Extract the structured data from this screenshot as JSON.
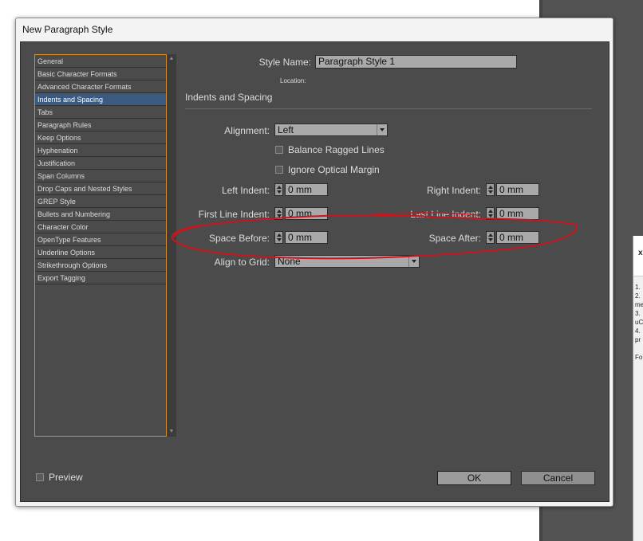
{
  "dialog": {
    "title": "New Paragraph Style"
  },
  "categories": [
    "General",
    "Basic Character Formats",
    "Advanced Character Formats",
    "Indents and Spacing",
    "Tabs",
    "Paragraph Rules",
    "Keep Options",
    "Hyphenation",
    "Justification",
    "Span Columns",
    "Drop Caps and Nested Styles",
    "GREP Style",
    "Bullets and Numbering",
    "Character Color",
    "OpenType Features",
    "Underline Options",
    "Strikethrough Options",
    "Export Tagging"
  ],
  "selected_category": "Indents and Spacing",
  "style_name": {
    "label": "Style Name:",
    "value": "Paragraph Style 1"
  },
  "location_label": "Location:",
  "section_title": "Indents and Spacing",
  "alignment": {
    "label": "Alignment:",
    "value": "Left"
  },
  "balance_ragged_lines": {
    "label": "Balance Ragged Lines",
    "checked": false
  },
  "ignore_optical_margin": {
    "label": "Ignore Optical Margin",
    "checked": false
  },
  "left_indent": {
    "label": "Left Indent:",
    "value": "0 mm"
  },
  "right_indent": {
    "label": "Right Indent:",
    "value": "0 mm"
  },
  "first_line_indent": {
    "label": "First Line Indent:",
    "value": "0 mm"
  },
  "last_line_indent": {
    "label": "Last Line Indent:",
    "value": "0 mm"
  },
  "space_before": {
    "label": "Space Before:",
    "value": "0 mm"
  },
  "space_after": {
    "label": "Space After:",
    "value": "0 mm"
  },
  "align_to_grid": {
    "label": "Align to Grid:",
    "value": "None"
  },
  "preview": {
    "label": "Preview",
    "checked": false
  },
  "buttons": {
    "ok": "OK",
    "cancel": "Cancel"
  },
  "side_panel": {
    "close": "x",
    "lines": [
      "1.",
      "2.",
      "me",
      "3.",
      "uC",
      "4.",
      "pr",
      "Fo"
    ]
  },
  "colors": {
    "panel_bg": "#4b4b4b",
    "selection": "#3b5a80",
    "list_border": "#d98c2a",
    "annotation_ink": "#c8161d"
  }
}
